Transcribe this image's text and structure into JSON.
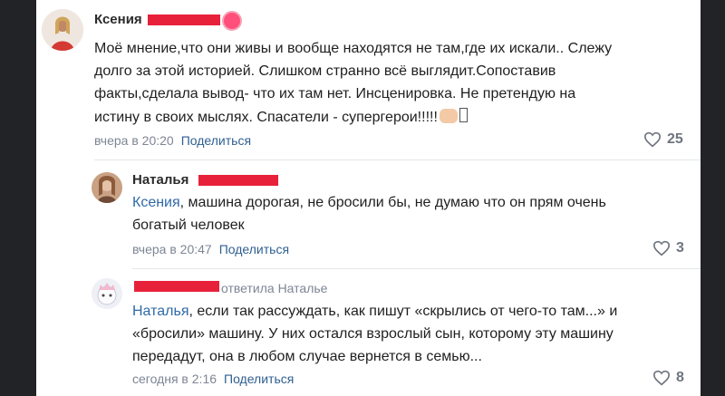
{
  "comments": [
    {
      "author": "Ксения",
      "lines": [
        "Моё мнение,что они живы и вообще находятся не там,где их искали.. Слежу",
        "долго за этой историей. Слишком странно всё выглядит.Сопоставив",
        "факты,сделала вывод- что их там нет. Инсценировка. Не претендую на",
        "истину в своих мыслях. Спасатели - супергерои!!!!!"
      ],
      "time": "вчера в 20:20",
      "share": "Поделиться",
      "likes": "25"
    },
    {
      "author": "Наталья",
      "mention": "Ксения",
      "lines": [
        ", машина дорогая, не бросили бы, не думаю что он прям очень",
        "богатый человек"
      ],
      "time": "вчера в 20:47",
      "share": "Поделиться",
      "likes": "3"
    },
    {
      "reply_to": "ответила Наталье",
      "mention": "Наталья",
      "lines": [
        ", если так рассуждать, как пишут «скрылись от чего-то там...» и",
        "«бросили» машину. У них остался взрослый сын, которому эту машину",
        "передадут, она в любом случае вернется в семью..."
      ],
      "time": "сегодня в 2:16",
      "share": "Поделиться",
      "likes": "8"
    }
  ],
  "colors": {
    "background": "#222326",
    "link": "#2f6aa8",
    "meta": "#7d8694",
    "redaction": "#e8213a"
  }
}
